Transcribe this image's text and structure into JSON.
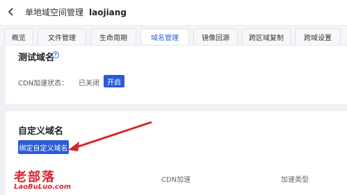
{
  "header": {
    "back_icon": "chevron-left-icon",
    "breadcrumb_parent": "单地域空间管理",
    "breadcrumb_separator": "/",
    "breadcrumb_current": "laojiang"
  },
  "tabs": [
    {
      "label": "概览",
      "active": false
    },
    {
      "label": "文件管理",
      "active": false
    },
    {
      "label": "生命周期",
      "active": false
    },
    {
      "label": "域名管理",
      "active": true
    },
    {
      "label": "镜像回源",
      "active": false
    },
    {
      "label": "跨区域复制",
      "active": false
    },
    {
      "label": "跨域设置",
      "active": false
    }
  ],
  "test_domain": {
    "title": "测试域名",
    "help_icon": "question-circle-icon",
    "cdn_label": "CDN加速状态：",
    "cdn_status": "已关闭",
    "enable_button": "开启"
  },
  "custom_domain": {
    "title": "自定义域名",
    "bind_button": "绑定自定义域名",
    "columns": [
      "CDN加速",
      "加速类型"
    ]
  },
  "watermark": {
    "text_cn": "老部落",
    "text_en": "LaoBuLuo.com"
  },
  "colors": {
    "accent": "#2b5bd7",
    "watermark": "#d9232e",
    "background": "#eef0f4"
  }
}
